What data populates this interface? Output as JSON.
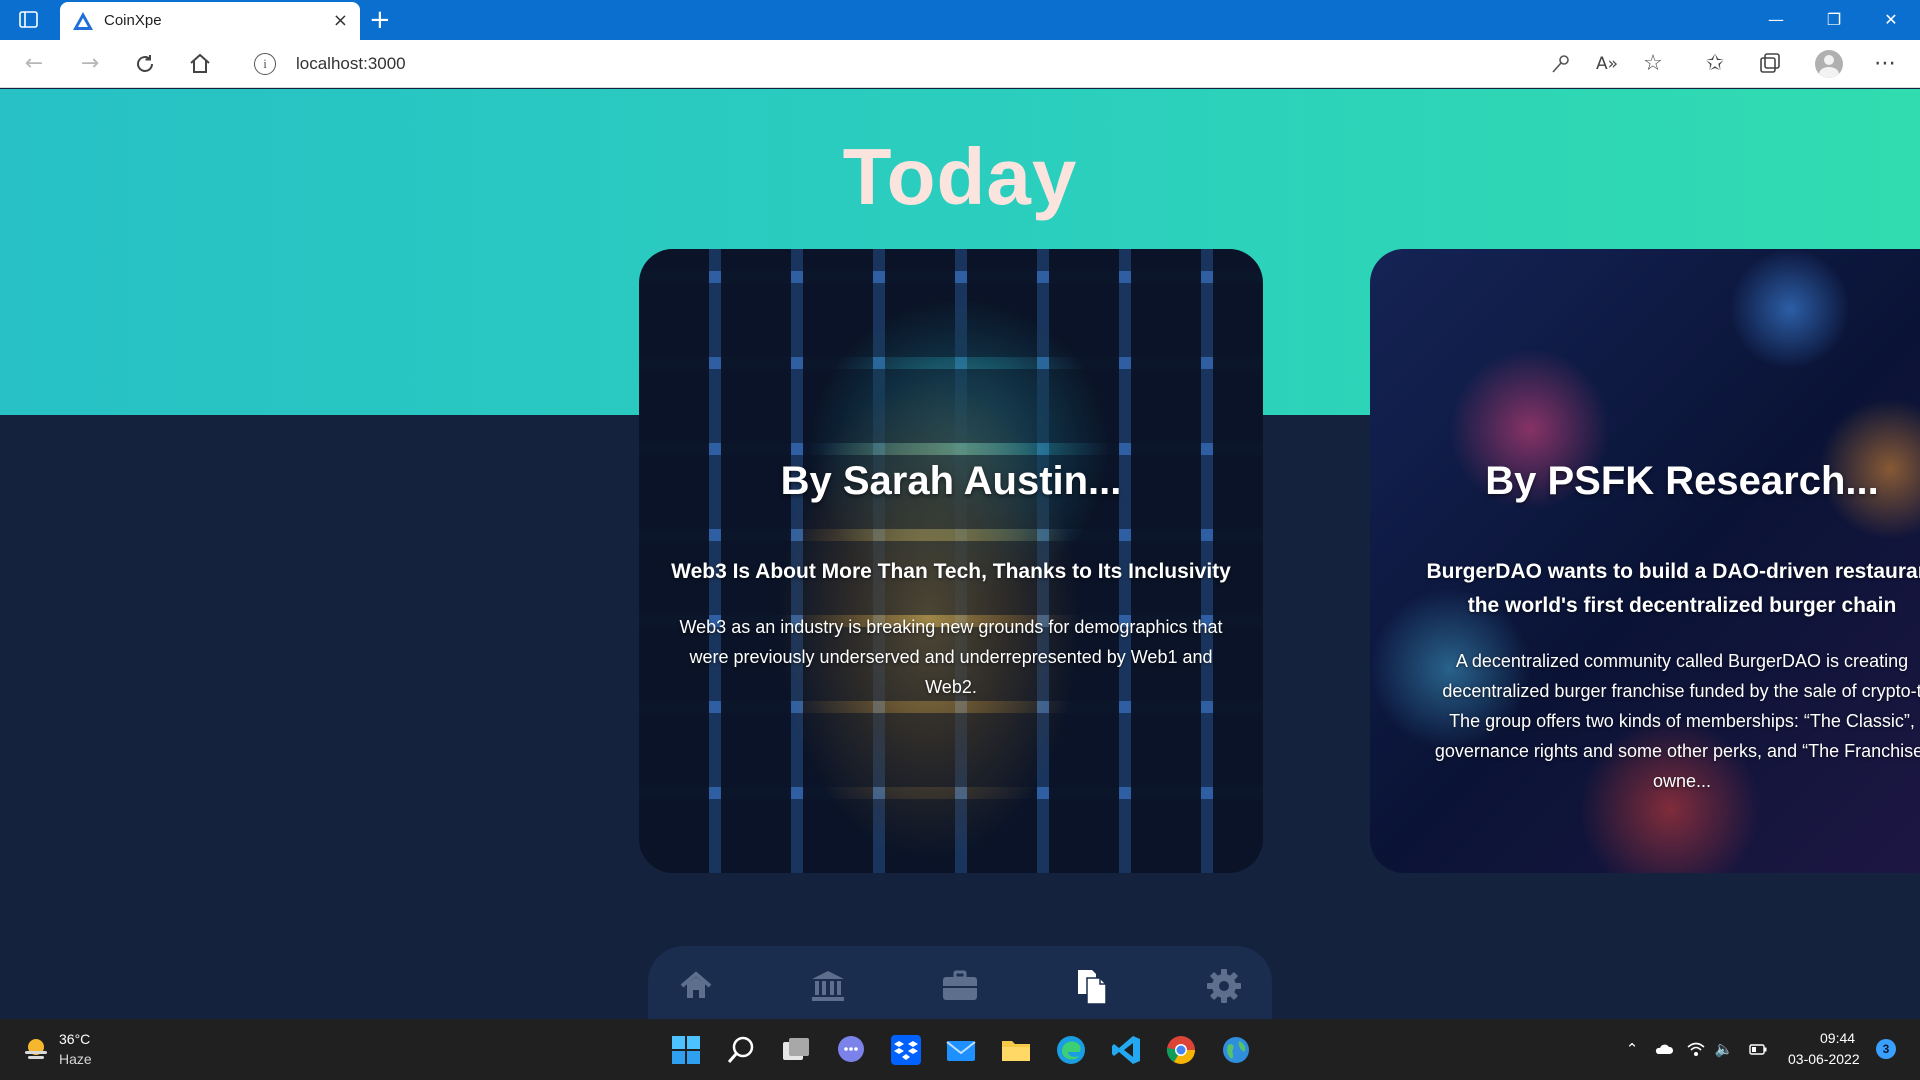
{
  "browser": {
    "tab_title": "CoinXpe",
    "tab_close": "×",
    "new_tab": "+",
    "url": "localhost:3000",
    "window_controls": {
      "minimize": "—",
      "restore": "❐",
      "close": "✕"
    }
  },
  "page": {
    "title": "Today",
    "colors": {
      "hero_start": "#27c1c6",
      "hero_end": "#31dcb0",
      "background": "#14223d",
      "title": "#fbe3de"
    }
  },
  "cards": [
    {
      "author": "By Sarah Austin...",
      "headline": "Web3 Is About More Than Tech, Thanks to Its Inclusivity",
      "body_lines": [
        "Web3 as an industry is breaking new grounds for demographics that",
        "were previously underserved and underrepresented by Web1 and",
        "Web2."
      ],
      "image": "bitcoin-on-keyboard"
    },
    {
      "author": "By PSFK Research...",
      "headline_lines": [
        "BurgerDAO wants to build a DAO-driven restaurant",
        "the world's first decentralized burger chain"
      ],
      "body_lines": [
        "A decentralized community called BurgerDAO is creating",
        "decentralized burger franchise funded by the sale of crypto-t",
        "The group offers two kinds of memberships: “The Classic”,",
        "governance rights and some other perks, and “The Franchise”",
        "owne..."
      ],
      "image": "abstract-circuit-board"
    }
  ],
  "bottom_nav": {
    "items": [
      "home-icon",
      "bank-icon",
      "briefcase-icon",
      "documents-icon",
      "gear-icon"
    ],
    "active": "documents-icon"
  },
  "taskbar": {
    "weather": {
      "temp": "36°C",
      "desc": "Haze"
    },
    "clock": {
      "time": "09:44",
      "date": "03-06-2022"
    },
    "notification_count": "3",
    "apps": [
      "start",
      "search",
      "task-view",
      "teams-chat",
      "dropbox",
      "mail",
      "file-explorer",
      "edge",
      "vscode",
      "chrome",
      "browser-globe"
    ]
  }
}
